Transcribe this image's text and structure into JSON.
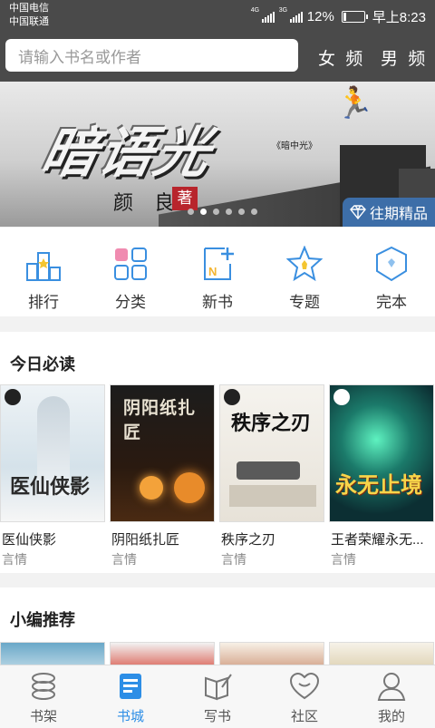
{
  "status_bar": {
    "carrier_1": "中国电信",
    "carrier_2": "中国联通",
    "network_1": "4G",
    "network_2": "3G",
    "battery": "12%",
    "battery_level": 0.12,
    "time": "早上8:23"
  },
  "header": {
    "search_placeholder": "请输入书名或作者",
    "tab_female": "女 频",
    "tab_male": "男 频"
  },
  "banner": {
    "title": "暗语光",
    "subtitle": "《暗中光》",
    "author": "颜 良",
    "author_seal": "著",
    "badge": "往期精品",
    "slide_count": 6,
    "active_slide": 1
  },
  "categories": [
    {
      "label": "排行",
      "icon": "ranking-icon"
    },
    {
      "label": "分类",
      "icon": "category-icon"
    },
    {
      "label": "新书",
      "icon": "new-book-icon"
    },
    {
      "label": "专题",
      "icon": "star-icon"
    },
    {
      "label": "完本",
      "icon": "finished-icon"
    }
  ],
  "today_read": {
    "title": "今日必读",
    "books": [
      {
        "name": "医仙侠影",
        "tag": "言情",
        "cover_text": "医仙侠影"
      },
      {
        "name": "阴阳纸扎匠",
        "tag": "言情",
        "cover_text": "阴阳纸扎匠"
      },
      {
        "name": "秩序之刃",
        "tag": "言情",
        "cover_text": "秩序之刃"
      },
      {
        "name": "王者荣耀永无...",
        "tag": "言情",
        "cover_text": "永无止境"
      }
    ]
  },
  "editor_pick": {
    "title": "小编推荐"
  },
  "bottom_nav": [
    {
      "label": "书架",
      "icon": "bookshelf-icon"
    },
    {
      "label": "书城",
      "icon": "bookstore-icon"
    },
    {
      "label": "写书",
      "icon": "write-icon"
    },
    {
      "label": "社区",
      "icon": "community-icon"
    },
    {
      "label": "我的",
      "icon": "profile-icon"
    }
  ],
  "colors": {
    "header_bg": "#4a4a4a",
    "accent": "#2d8ee6",
    "icon_blue": "#3a8fe0",
    "badge_blue": "#3d6ea8"
  }
}
